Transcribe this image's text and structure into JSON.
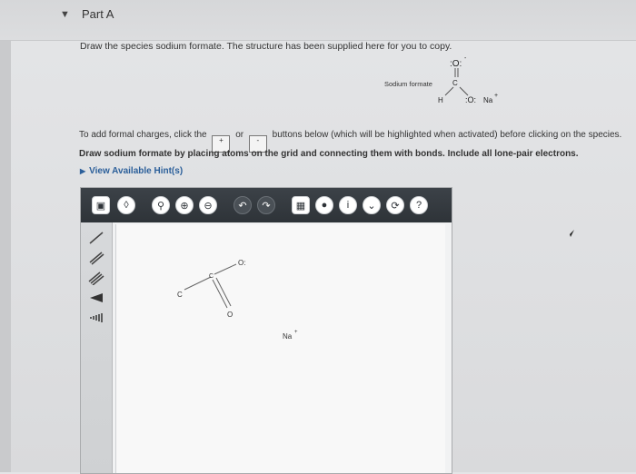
{
  "part": {
    "title": "Part A",
    "collapse_icon": "caret-down-icon"
  },
  "instructions": {
    "draw_species": "Draw the species sodium formate. The structure has been supplied here for you to copy.",
    "formal_charge_prefix": "To add formal charges, click the",
    "plus_label": "+",
    "or_text": "or",
    "minus_label": "-",
    "formal_charge_suffix": "buttons below (which will be highlighted when activated) before clicking on the species.",
    "draw_method": "Draw sodium formate by placing atoms on the grid and connecting them with bonds. Include all lone-pair electrons."
  },
  "reference_structure": {
    "label": "Sodium formate",
    "atoms": {
      "top_o": ":O:",
      "carbon": "C",
      "hydrogen": "H",
      "bottom_o": ":O:",
      "charge": "-",
      "sodium": "Na",
      "sodium_charge": "+"
    }
  },
  "hints": {
    "label": "View Available Hint(s)"
  },
  "toolbar": {
    "buttons": [
      "template-icon",
      "eraser-icon",
      "zoom-fit-icon",
      "zoom-in-icon",
      "zoom-out-icon",
      "undo-icon",
      "redo-icon",
      "clean-icon",
      "lightbulb-icon",
      "info-icon",
      "dropdown-icon",
      "reset-icon",
      "help-icon"
    ]
  },
  "sidebar": {
    "tools": [
      "single-bond-tool",
      "double-bond-tool",
      "triple-bond-tool",
      "wedge-bond-tool",
      "hash-bond-tool"
    ]
  },
  "canvas": {
    "atoms": {
      "c1": "C",
      "c2": "C",
      "o_top": "O:",
      "o_bottom": "O",
      "na": "Na",
      "na_charge": "+"
    }
  },
  "colors": {
    "toolbar_bg": "#2e3338",
    "hint_link": "#2b5f9a",
    "canvas_bg": "#f8f8f8"
  }
}
